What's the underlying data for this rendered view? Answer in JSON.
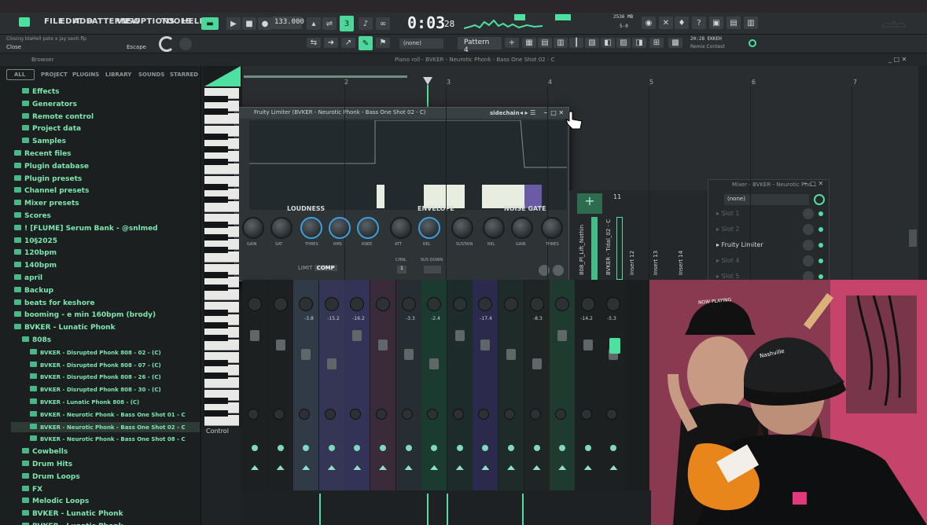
{
  "menu": {
    "items": [
      "FILE",
      "EDIT",
      "ADD",
      "PATTERNS",
      "VIEW",
      "OPTIONS",
      "TOOLS",
      "HELP"
    ],
    "project_hint": "Closing blaHell pete x jay seoh.flp",
    "hint_left": "Close",
    "hint_right": "Escape"
  },
  "transport": {
    "tempo": "133.000",
    "time": "0:03",
    "time_frac": "28",
    "cpu": "2536 MB",
    "voices": "5-0"
  },
  "toolbar2": {
    "snap": "(none)",
    "pattern": "Pattern 4",
    "project_title": "20:28 EKKEH",
    "project_sub": "Remix Contest"
  },
  "browser": {
    "title": "Browser",
    "tabs": [
      "ALL",
      "PROJECT",
      "PLUGINS",
      "LIBRARY",
      "SOUNDS",
      "STARRED"
    ],
    "items": [
      {
        "label": "Effects",
        "depth": 1
      },
      {
        "label": "Generators",
        "depth": 1
      },
      {
        "label": "Remote control",
        "depth": 1
      },
      {
        "label": "Project data",
        "depth": 1
      },
      {
        "label": "Samples",
        "depth": 1
      },
      {
        "label": "Recent files",
        "depth": 0
      },
      {
        "label": "Plugin database",
        "depth": 0
      },
      {
        "label": "Plugin presets",
        "depth": 0
      },
      {
        "label": "Channel presets",
        "depth": 0
      },
      {
        "label": "Mixer presets",
        "depth": 0
      },
      {
        "label": "Scores",
        "depth": 0
      },
      {
        "label": "! [FLUME] Serum Bank - @snlmed",
        "depth": 0
      },
      {
        "label": "10§2025",
        "depth": 0
      },
      {
        "label": "120bpm",
        "depth": 0
      },
      {
        "label": "140bpm",
        "depth": 0
      },
      {
        "label": "april",
        "depth": 0
      },
      {
        "label": "Backup",
        "depth": 0
      },
      {
        "label": "beats for keshore",
        "depth": 0
      },
      {
        "label": "booming - e min 160bpm (brody)",
        "depth": 0
      },
      {
        "label": "BVKER - Lunatic Phonk",
        "depth": 0
      },
      {
        "label": "808s",
        "depth": 1
      },
      {
        "label": "BVKER - Disrupted Phonk 808 - 02 - (C)",
        "depth": 2
      },
      {
        "label": "BVKER - Disrupted Phonk 808 - 07 - (C)",
        "depth": 2
      },
      {
        "label": "BVKER - Disrupted Phonk 808 - 26 - (C)",
        "depth": 2
      },
      {
        "label": "BVKER - Disrupted Phonk 808 - 30 - (C)",
        "depth": 2
      },
      {
        "label": "BVKER - Lunatic Phonk 808 - (C)",
        "depth": 2
      },
      {
        "label": "BVKER - Neurotic Phonk - Bass One Shot 01 - C",
        "depth": 2
      },
      {
        "label": "BVKER - Neurotic Phonk - Bass One Shot 02 - C",
        "depth": 2
      },
      {
        "label": "BVKER - Neurotic Phonk - Bass One Shot 08 - C",
        "depth": 2
      },
      {
        "label": "Cowbells",
        "depth": 1
      },
      {
        "label": "Drum Hits",
        "depth": 1
      },
      {
        "label": "Drum Loops",
        "depth": 1
      },
      {
        "label": "FX",
        "depth": 1
      },
      {
        "label": "Melodic Loops",
        "depth": 1
      },
      {
        "label": "BVKER - Lunatic Phonk",
        "depth": 1
      },
      {
        "label": "BVKER - Lunatic Phonk",
        "depth": 1
      }
    ],
    "selected_index": 27
  },
  "piano_roll": {
    "title": "Piano roll - BVKER - Neurotic Phonk - Bass One Shot 02 - C",
    "ruler": [
      "2",
      "3",
      "4",
      "5",
      "6",
      "7"
    ],
    "control_label": "Control"
  },
  "limiter": {
    "title": "Fruity Limiter (BVKER - Neurotic Phonk - Bass One Shot 02 - C)",
    "sidechain": "sidechain",
    "sections": [
      "LOUDNESS",
      "ENVELOPE",
      "NOISE GATE"
    ],
    "knobs": [
      "GAIN",
      "SAT",
      "THRES",
      "RMS",
      "KNEE",
      "ATT",
      "REL",
      "SUSTAIN",
      "REL",
      "GAIN",
      "THRES"
    ],
    "mode_limit": "LIMIT",
    "mode_comp": "COMP",
    "ch_label": "CHNL",
    "ch_value": "1",
    "sustain_label": "SUS DOWN"
  },
  "mixer": {
    "db_values": [
      "-3.8",
      "-15.2",
      "-16.2",
      "-3.3",
      "-2.4",
      "-17.4",
      "-8.3",
      "-14.2",
      "-5.3"
    ],
    "strip_names": [
      "808_Pl_Lift_Nothin",
      "BVKER - Tidal_02 - C",
      "Insert 12",
      "Insert 13",
      "Insert 14"
    ],
    "insert_number": "11"
  },
  "mixer_panel": {
    "title": "Mixer - BVKER - Neurotic Pho...",
    "preset": "(none)",
    "slots": [
      "Slot 1",
      "Slot 2",
      "Fruity Limiter",
      "Slot 4",
      "Slot 5"
    ]
  },
  "webcam": {
    "hat_text": "NOW PLAYING",
    "cap_text": "Nashville"
  },
  "colors": {
    "accent": "#4ee0a0",
    "panel": "#2e3336",
    "webcam_bg": "#8e3d52"
  }
}
